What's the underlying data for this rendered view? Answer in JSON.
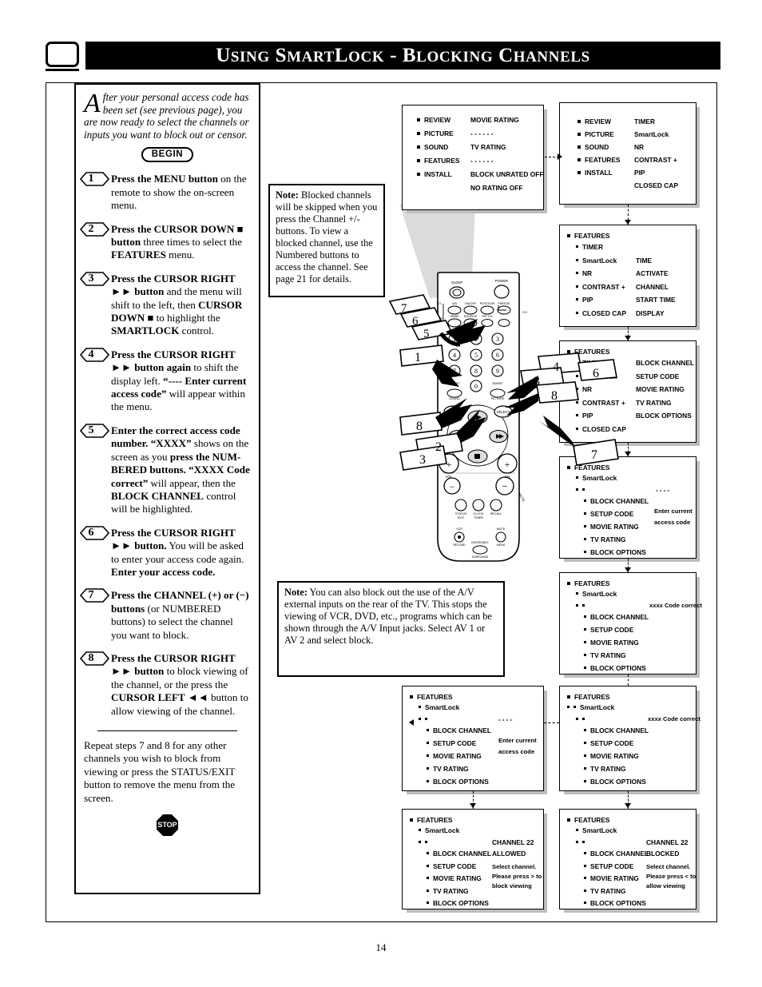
{
  "header": {
    "title_parts": [
      {
        "big": "U",
        "small": "SING"
      },
      {
        "big": "S",
        "small": "MART"
      },
      {
        "big": "L",
        "small": "OCK"
      },
      {
        "sep": "-"
      },
      {
        "big": "B",
        "small": "LOCKING"
      },
      {
        "big": "C",
        "small": "HANNELS"
      }
    ],
    "title_plain": "Using SmartLock - Blocking Channels",
    "corner_icon": "rounded-square-icon"
  },
  "intro": {
    "dropcap": "A",
    "text": "fter your personal access code has been set (see previous page), you are now ready to select the channels or inputs you want to block out or censor."
  },
  "begin_label": "BEGIN",
  "stop_label": "STOP",
  "steps": [
    {
      "num": "1",
      "html": "<b>Press the MENU button</b> on the remote to show the on-screen menu."
    },
    {
      "num": "2",
      "html": "<b>Press the CURSOR DOWN &#9632; button</b> three times to select the <b>FEATURES</b> menu."
    },
    {
      "num": "3",
      "html": "<b>Press the CURSOR RIGHT &#9658;&#9658; button</b> and the menu will shift to the left, then <b>CURSOR DOWN &#9632;</b> to highlight the <b>SMARTLOCK</b> control."
    },
    {
      "num": "4",
      "html": "<b>Press the CURSOR RIGHT &#9658;&#9658; button again</b> to shift the display left.  <b>&ldquo;---- Enter current access code&rdquo;</b> will appear within the menu."
    },
    {
      "num": "5",
      "html": "<b>Enter the correct access code number. &ldquo;XXXX&rdquo;</b> shows on the screen as you <b>press the NUM-BERED buttons. &ldquo;XXXX Code correct&rdquo;</b> will appear, then the <b>BLOCK CHANNEL</b> control will be highlighted."
    },
    {
      "num": "6",
      "html": "<b>Press the CURSOR RIGHT &#9658;&#9658; button.</b> You will be asked to enter your access code again. <b>Enter your access code.</b>"
    },
    {
      "num": "7",
      "html": "<b>Press the CHANNEL (+) or (&minus;) buttons</b> (or NUMBERED buttons) to select the channel you want to block."
    },
    {
      "num": "8",
      "html": "<b>Press the CURSOR RIGHT &#9658;&#9658; button</b> to block viewing of the channel, or the press the <b>CURSOR LEFT &#9668;&#9668;</b> button to allow viewing of the channel."
    }
  ],
  "closing": "Repeat steps 7 and 8 for any other channels you wish to block from viewing or press the STATUS/EXIT button to remove the menu from the screen.",
  "notes": [
    {
      "id": "note1",
      "label": "Note:",
      "text": "Blocked channels will be skipped when you press the Channel +/- buttons. To view a blocked channel, use the Numbered buttons to access the channel. See page 21 for details."
    },
    {
      "id": "note2",
      "label": "Note:",
      "text": "You can also block out the use of the A/V external inputs on the rear of the TV. This stops the viewing of VCR, DVD, etc., programs which can be shown through the A/V Input jacks. Select AV 1 or AV 2 and select block."
    }
  ],
  "menus": {
    "m1": {
      "name": "ratings-menu",
      "left": [
        "REVIEW",
        "PICTURE",
        "SOUND",
        "FEATURES",
        "INSTALL"
      ],
      "right": [
        "MOVIE RATING",
        "- - - - - -",
        "TV RATING",
        "- - - - - -",
        "BLOCK UNRATED  OFF",
        "NO RATING          OFF"
      ]
    },
    "m2": {
      "name": "main-menu-features",
      "left": [
        "REVIEW",
        "PICTURE",
        "SOUND",
        "FEATURES",
        "INSTALL"
      ],
      "right": [
        "TIMER",
        "SmartLock",
        "NR",
        "CONTRAST +",
        "PIP",
        "CLOSED CAP"
      ]
    },
    "m3": {
      "name": "features-timer-menu",
      "title": "FEATURES",
      "left": [
        "TIMER",
        "SmartLock",
        "NR",
        "CONTRAST +",
        "PIP",
        "CLOSED CAP"
      ],
      "right": [
        "",
        "TIME",
        "ACTIVATE",
        "CHANNEL",
        "START TIME",
        "DISPLAY"
      ]
    },
    "m4": {
      "name": "features-smartlock-menu",
      "title": "FEATURES",
      "left": [
        "TIMER",
        "SmartLock",
        "NR",
        "CONTRAST +",
        "PIP",
        "CLOSED CAP"
      ],
      "right": [
        "BLOCK CHANNEL",
        "SETUP CODE",
        "MOVIE RATING",
        "TV RATING",
        "BLOCK OPTIONS",
        ""
      ]
    },
    "m5": {
      "name": "smartlock-enter-code-menu",
      "title": "FEATURES",
      "sub": "SmartLock",
      "code_field": "----",
      "items": [
        "BLOCK CHANNEL",
        "SETUP CODE",
        "MOVIE RATING",
        "TV RATING",
        "BLOCK OPTIONS"
      ],
      "msg_line1": "Enter current",
      "msg_line2": "access code"
    },
    "m6": {
      "name": "smartlock-code-correct-menu",
      "title": "FEATURES",
      "sub": "SmartLock",
      "status": "xxxx Code correct",
      "items": [
        "BLOCK CHANNEL",
        "SETUP CODE",
        "MOVIE RATING",
        "TV RATING",
        "BLOCK OPTIONS"
      ]
    },
    "m7": {
      "name": "smartlock-enter-code-menu-2",
      "title": "FEATURES",
      "sub": "SmartLock",
      "code_field": "----",
      "items": [
        "BLOCK CHANNEL",
        "SETUP CODE",
        "MOVIE RATING",
        "TV RATING",
        "BLOCK OPTIONS"
      ],
      "msg_line1": "Enter current",
      "msg_line2": "access code"
    },
    "m8": {
      "name": "smartlock-code-correct-menu-2",
      "title": "FEATURES",
      "sub": "SmartLock",
      "status": "xxxx Code correct",
      "items": [
        "BLOCK CHANNEL",
        "SETUP CODE",
        "MOVIE RATING",
        "TV RATING",
        "BLOCK OPTIONS"
      ]
    },
    "m9": {
      "name": "block-channel-allowed-menu",
      "title": "FEATURES",
      "sub": "SmartLock",
      "channel": "CHANNEL 22",
      "state": "ALLOWED",
      "items": [
        "BLOCK CHANNEL",
        "SETUP CODE",
        "MOVIE RATING",
        "TV RATING",
        "BLOCK OPTIONS"
      ],
      "msg_line1": "Select channel.",
      "msg_line2": "Please press > to",
      "msg_line3": "block viewing"
    },
    "m10": {
      "name": "block-channel-blocked-menu",
      "title": "FEATURES",
      "sub": "SmartLock",
      "channel": "CHANNEL 22",
      "state": "BLOCKED",
      "items": [
        "BLOCK CHANNEL",
        "SETUP CODE",
        "MOVIE RATING",
        "TV RATING",
        "BLOCK OPTIONS"
      ],
      "msg_line1": "Select channel.",
      "msg_line2": "Please press < to",
      "msg_line3": "allow viewing"
    }
  },
  "remote": {
    "name": "tv-remote-control",
    "button_labels": [
      "SLEEP",
      "POWER",
      "TV",
      "VCR",
      "A/S",
      "ON/OFF",
      "POSITION",
      "FREEZE",
      "SWAP",
      "SOURCE",
      "PIP CH",
      "MENU",
      "SELECT",
      "VOL",
      "CH",
      "STATUS/EXIT",
      "CLOCK/TIMER",
      "RECALL",
      "VCR RECORD",
      "MUTE",
      "INCREDIBLE SURROUND"
    ],
    "numbers": [
      "1",
      "2",
      "3",
      "4",
      "5",
      "6",
      "7",
      "8",
      "9",
      "0"
    ],
    "callouts": [
      "1",
      "2",
      "3",
      "4",
      "5",
      "6",
      "7",
      "8"
    ]
  },
  "page_number": "14"
}
